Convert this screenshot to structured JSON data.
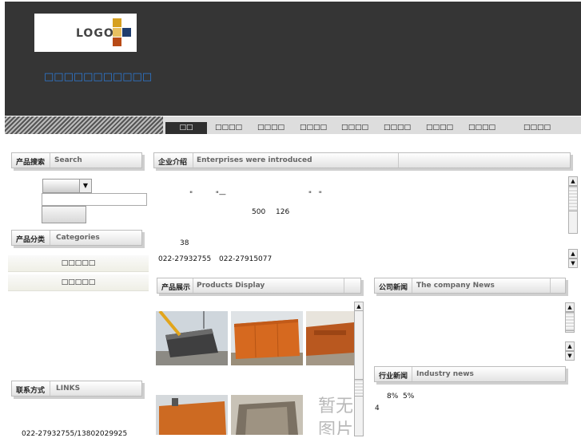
{
  "header": {
    "logo_text": "LOGO",
    "site_name": "□□□□□□□□□□□",
    "logo_colors": [
      "#d6a020",
      "#1f3d6e",
      "#b84a16"
    ]
  },
  "nav": {
    "items": [
      "□□",
      "□□□□",
      "□□□□",
      "□□□□",
      "□□□□",
      "□□□□",
      "□□□□",
      "□□□□",
      "□□□□"
    ],
    "active_index": 0
  },
  "search": {
    "title_cn": "产品搜索",
    "title_en": "Search",
    "select_value": "",
    "input_value": "",
    "button_label": ""
  },
  "categories": {
    "title_cn": "产品分类",
    "title_en": "Categories",
    "items": [
      "□□□□□",
      "□□□□□"
    ]
  },
  "links": {
    "title_cn": "联系方式",
    "title_en": "LINKS",
    "phone_partial": "022-27932755/13802029925"
  },
  "intro": {
    "title_cn": "企业介绍",
    "title_en": "Enterprises were introduced",
    "line1": "\"          \"—                                    \"   \"",
    "line2_a": "500",
    "line2_b": "126",
    "line3": "38",
    "phone1": "022-27932755",
    "phone2": "022-27915077"
  },
  "products": {
    "title_cn": "产品展示",
    "title_en": "Products Display",
    "placeholder_text": "暂无 图片"
  },
  "company_news": {
    "title_cn": "公司新闻",
    "title_en": "The company News"
  },
  "industry_news": {
    "title_cn": "行业新闻",
    "title_en": "Industry news",
    "line1": "8%  5%",
    "line2": "4"
  }
}
